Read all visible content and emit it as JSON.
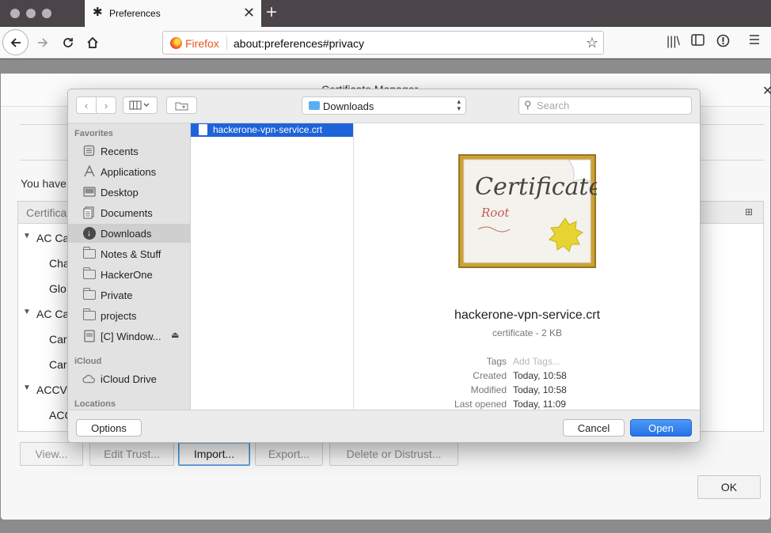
{
  "browser": {
    "tab_title": "Preferences",
    "url_label": "Firefox",
    "url": "about:preferences#privacy",
    "new_tab": "+"
  },
  "cert_manager": {
    "title": "Certificate Manager",
    "you_have": "You have",
    "column_header": "Certifica",
    "rows": [
      {
        "label": "AC Ca",
        "twisty": "▼"
      },
      {
        "label": "Cha",
        "twisty": ""
      },
      {
        "label": "Glo",
        "twisty": ""
      },
      {
        "label": "AC Ca",
        "twisty": "▼"
      },
      {
        "label": "Car",
        "twisty": ""
      },
      {
        "label": "Car",
        "twisty": ""
      },
      {
        "label": "ACCV",
        "twisty": "▼"
      },
      {
        "label": "ACC",
        "twisty": ""
      }
    ],
    "buttons": {
      "view": "View...",
      "edit_trust": "Edit Trust...",
      "import": "Import...",
      "export": "Export...",
      "delete": "Delete or Distrust...",
      "ok": "OK"
    }
  },
  "dialog": {
    "location": "Downloads",
    "search_placeholder": "Search",
    "sidebar": {
      "favorites_header": "Favorites",
      "favorites": [
        {
          "label": "Recents",
          "icon": "recents-icon"
        },
        {
          "label": "Applications",
          "icon": "applications-icon"
        },
        {
          "label": "Desktop",
          "icon": "desktop-icon"
        },
        {
          "label": "Documents",
          "icon": "documents-icon"
        },
        {
          "label": "Downloads",
          "icon": "downloads-icon",
          "selected": true
        },
        {
          "label": "Notes & Stuff",
          "icon": "folder-icon"
        },
        {
          "label": "HackerOne",
          "icon": "folder-icon"
        },
        {
          "label": "Private",
          "icon": "folder-icon"
        },
        {
          "label": "projects",
          "icon": "folder-icon"
        },
        {
          "label": "[C] Window...",
          "icon": "drive-icon"
        }
      ],
      "icloud_header": "iCloud",
      "icloud_drive": "iCloud Drive",
      "locations_header": "Locations"
    },
    "file": "hackerone-vpn-service.crt",
    "preview": {
      "name": "hackerone-vpn-service.crt",
      "kind": "certificate - 2 KB",
      "cert_title": "Certificate",
      "cert_sub": "Root",
      "meta": [
        {
          "key": "Tags",
          "value": "Add Tags...",
          "placeholder": true
        },
        {
          "key": "Created",
          "value": "Today, 10:58"
        },
        {
          "key": "Modified",
          "value": "Today, 10:58"
        },
        {
          "key": "Last opened",
          "value": "Today, 11:09"
        }
      ]
    },
    "buttons": {
      "options": "Options",
      "cancel": "Cancel",
      "open": "Open"
    }
  }
}
